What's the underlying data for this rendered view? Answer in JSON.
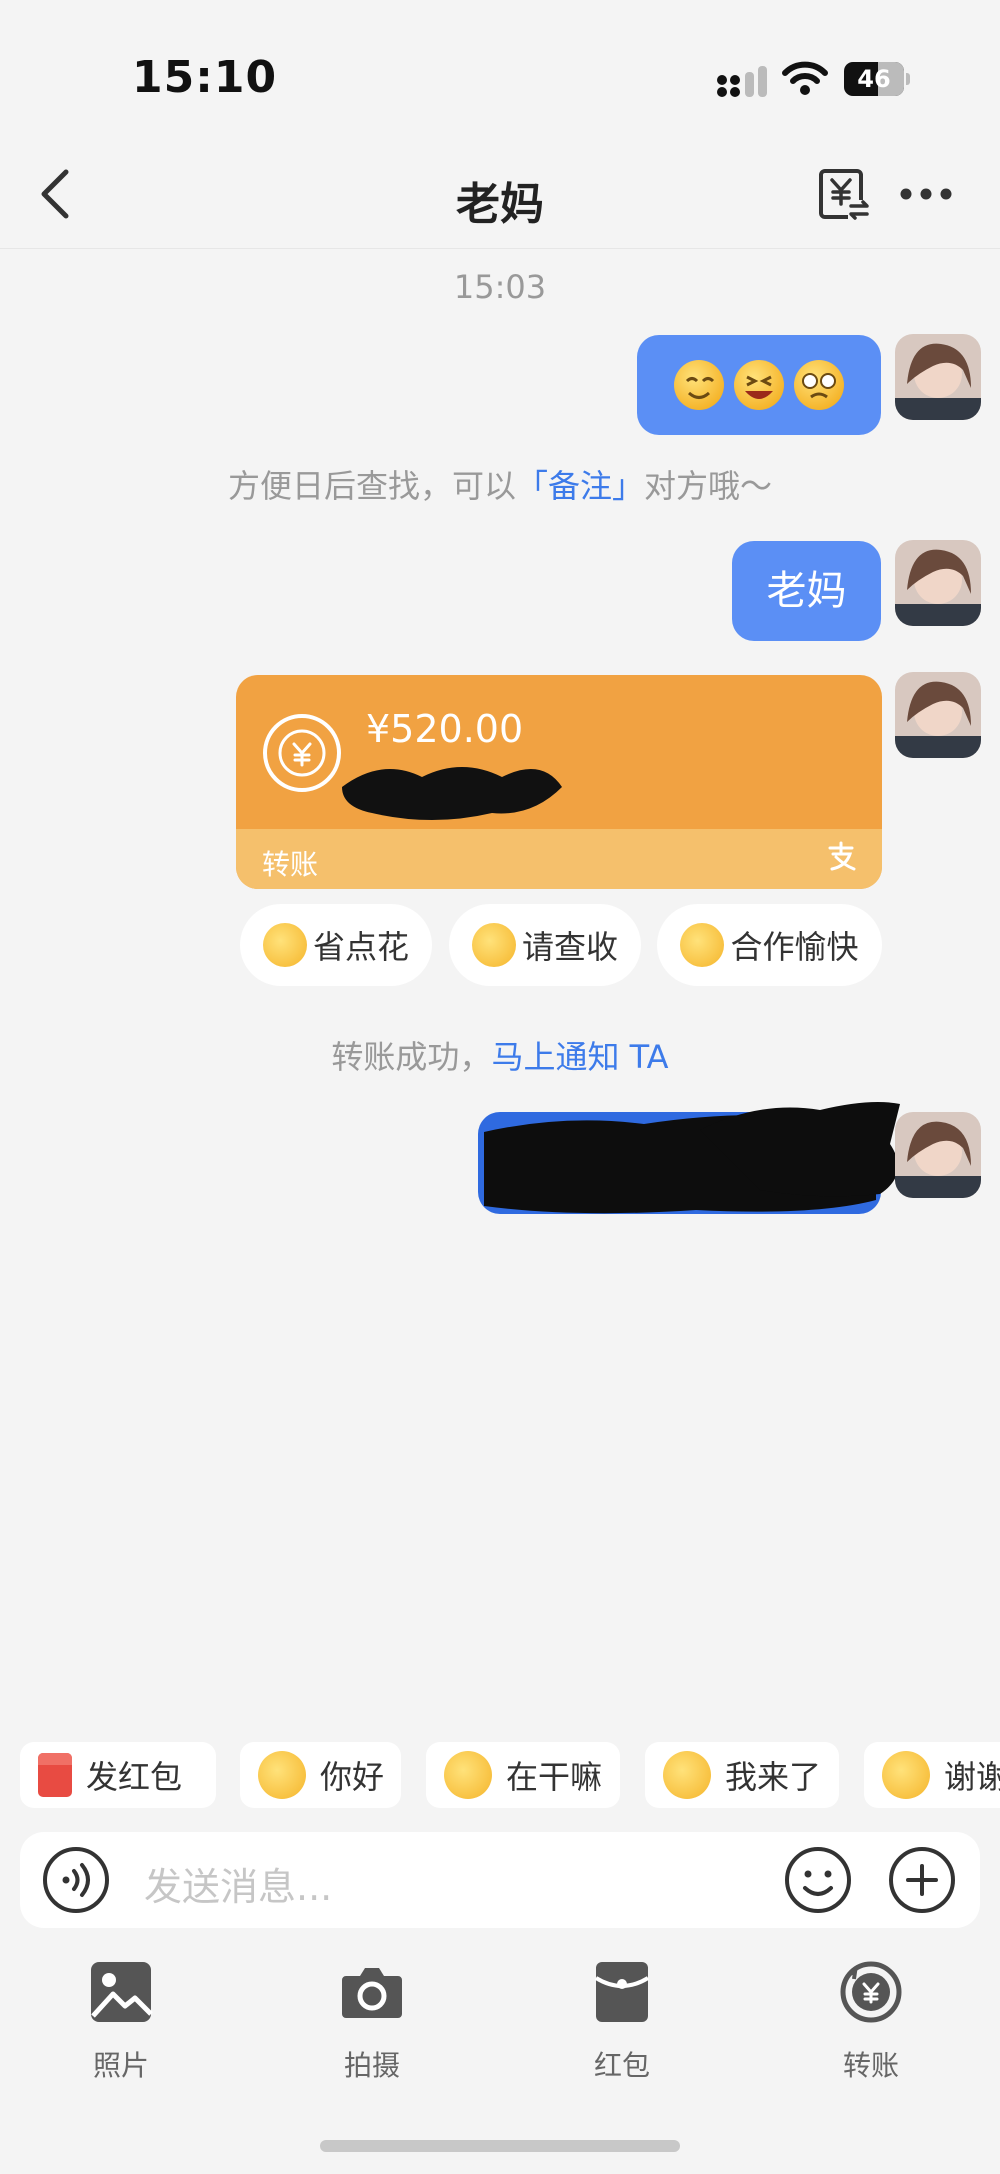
{
  "status_bar": {
    "time": "15:10",
    "battery": "46"
  },
  "nav": {
    "title": "老妈",
    "back_icon": "chevron-left-icon",
    "transfer_icon": "yen-transfer-icon",
    "more_icon": "more-icon"
  },
  "chat": {
    "timestamp": "15:03",
    "note": {
      "prefix": "方便日后查找，可以",
      "bracket_open": "「",
      "link": "备注",
      "bracket_close": "」",
      "suffix": "对方哦～"
    },
    "text_message": "老妈",
    "transfer": {
      "amount": "¥520.00",
      "label": "转账"
    },
    "quick_replies": [
      {
        "label": "省点花"
      },
      {
        "label": "请查收"
      },
      {
        "label": "合作愉快"
      }
    ],
    "success_note": {
      "prefix": "转账成功，",
      "link": "马上通知 TA"
    }
  },
  "chips": [
    {
      "label": "发红包"
    },
    {
      "label": "你好"
    },
    {
      "label": "在干嘛"
    },
    {
      "label": "我来了"
    },
    {
      "label": "谢谢"
    }
  ],
  "input": {
    "placeholder": "发送消息..."
  },
  "toolbar": [
    {
      "label": "照片",
      "icon": "photo-icon"
    },
    {
      "label": "拍摄",
      "icon": "camera-icon"
    },
    {
      "label": "红包",
      "icon": "red-packet-icon"
    },
    {
      "label": "转账",
      "icon": "transfer-icon"
    }
  ],
  "colors": {
    "blue_bubble": "#5b8ff5",
    "transfer_orange": "#f1a242",
    "link_blue": "#3d7bea"
  }
}
